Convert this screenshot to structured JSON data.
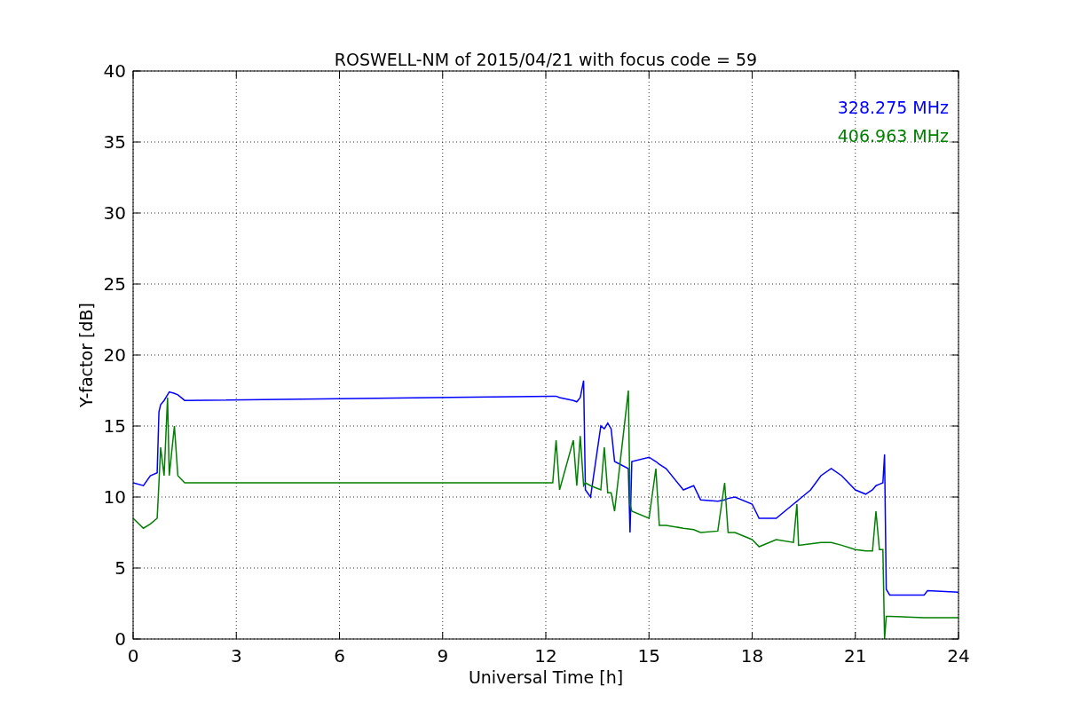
{
  "chart_data": {
    "type": "line",
    "title": "ROSWELL-NM of 2015/04/21 with focus code = 59",
    "xlabel": "Universal Time [h]",
    "ylabel": "Y-factor [dB]",
    "x": [
      0,
      0.3,
      0.5,
      0.7,
      0.75,
      0.8,
      0.9,
      1.0,
      1.05,
      1.2,
      1.3,
      1.5,
      12.2,
      12.3,
      12.4,
      12.8,
      12.9,
      13.0,
      13.1,
      13.15,
      13.3,
      13.6,
      13.7,
      13.8,
      13.9,
      14.0,
      14.4,
      14.45,
      14.5,
      15.0,
      15.2,
      15.3,
      15.5,
      16.0,
      16.3,
      16.5,
      17.0,
      17.2,
      17.3,
      17.5,
      18.0,
      18.2,
      18.7,
      19.2,
      19.3,
      19.35,
      19.7,
      20.0,
      20.3,
      20.6,
      21.0,
      21.3,
      21.5,
      21.6,
      21.7,
      21.8,
      21.85,
      21.9,
      22.0,
      23.0,
      23.1,
      24.0
    ],
    "series": [
      {
        "name": "328.275 MHz",
        "color": "#0000ff",
        "values": [
          11,
          10.8,
          11.5,
          11.7,
          16,
          16.5,
          16.8,
          17.2,
          17.4,
          17.3,
          17.2,
          16.8,
          17.1,
          17.1,
          17,
          16.8,
          16.7,
          17,
          18.2,
          10.5,
          10,
          15,
          14.8,
          15.2,
          14.8,
          12.5,
          12,
          7.5,
          12.5,
          12.8,
          12.5,
          12.3,
          12,
          10.5,
          10.8,
          9.8,
          9.7,
          9.8,
          9.9,
          10,
          9.5,
          8.5,
          8.5,
          9.5,
          9.7,
          9.8,
          10.5,
          11.5,
          12,
          11.5,
          10.5,
          10.2,
          10.5,
          10.8,
          10.9,
          11,
          13,
          3.5,
          3.1,
          3.1,
          3.4,
          3.3
        ]
      },
      {
        "name": "406.963 MHz",
        "color": "#008000",
        "values": [
          8.5,
          7.8,
          8.1,
          8.5,
          11,
          13.5,
          11.5,
          17,
          11.5,
          15,
          11.5,
          11,
          11,
          14,
          10.5,
          14,
          10.8,
          14.3,
          10.8,
          11,
          10.8,
          10.5,
          13.5,
          10.3,
          10.3,
          9,
          17.5,
          9.5,
          9,
          8.5,
          12,
          8,
          8,
          7.8,
          7.7,
          7.5,
          7.6,
          11,
          7.5,
          7.5,
          7,
          6.5,
          7,
          6.8,
          9.5,
          6.6,
          6.7,
          6.8,
          6.8,
          6.6,
          6.3,
          6.2,
          6.2,
          9,
          6.3,
          6.3,
          0,
          1.6,
          1.6,
          1.5,
          1.5,
          1.5
        ]
      }
    ],
    "xlim": [
      0,
      24
    ],
    "ylim": [
      0,
      40
    ],
    "xticks": [
      0,
      3,
      6,
      9,
      12,
      15,
      18,
      21,
      24
    ],
    "yticks": [
      0,
      5,
      10,
      15,
      20,
      25,
      30,
      35,
      40
    ],
    "grid": true
  }
}
